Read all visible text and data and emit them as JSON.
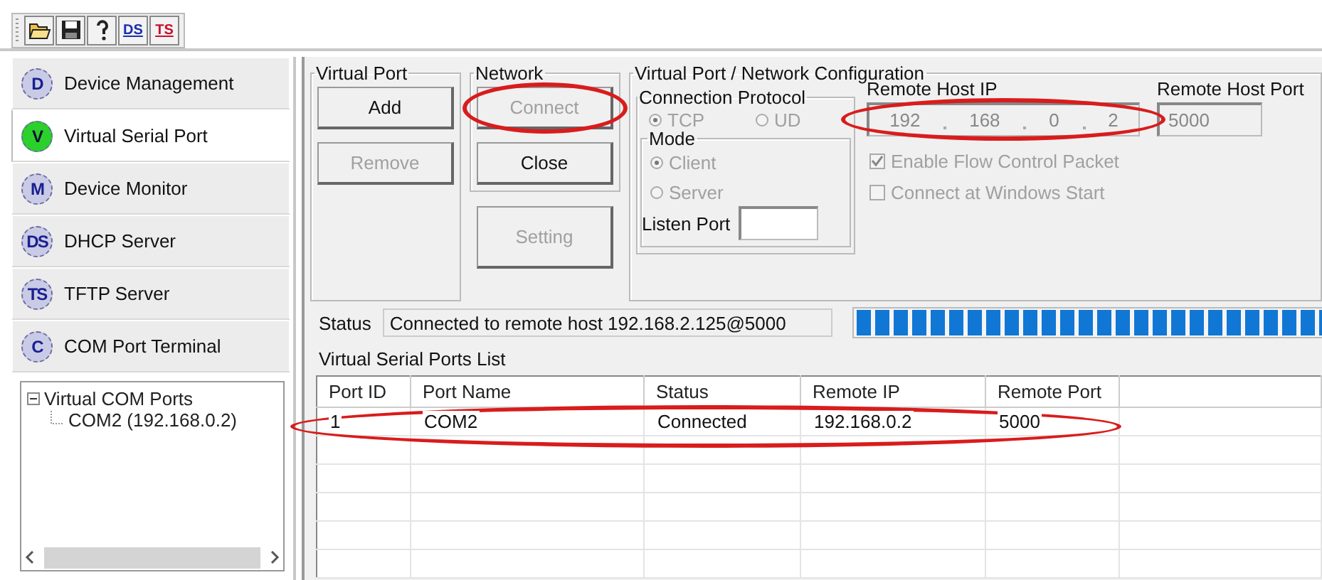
{
  "toolbar": {
    "buttons": [
      {
        "kind": "open"
      },
      {
        "kind": "save"
      },
      {
        "kind": "help"
      },
      {
        "kind": "text",
        "label": "DS",
        "color": "#1a2fb0"
      },
      {
        "kind": "text",
        "label": "TS",
        "color": "#c8102e"
      }
    ]
  },
  "sidebar": {
    "items": [
      {
        "badge": "D",
        "label": "Device Management",
        "selected": false
      },
      {
        "badge": "V",
        "label": "Virtual Serial Port",
        "selected": true
      },
      {
        "badge": "M",
        "label": "Device Monitor",
        "selected": false
      },
      {
        "badge": "DS",
        "label": "DHCP Server",
        "selected": false
      },
      {
        "badge": "TS",
        "label": "TFTP Server",
        "selected": false
      },
      {
        "badge": "C",
        "label": "COM Port Terminal",
        "selected": false
      }
    ]
  },
  "tree": {
    "items": [
      {
        "label": "Virtual COM Ports",
        "expanded": true,
        "children": [
          {
            "label": "COM2 (192.168.0.2)"
          }
        ]
      }
    ]
  },
  "virtual_port": {
    "title": "Virtual Port",
    "buttons": [
      {
        "label": "Add",
        "disabled": false,
        "highlighted": false
      },
      {
        "label": "Remove",
        "disabled": true,
        "highlighted": false
      }
    ]
  },
  "network": {
    "title": "Network",
    "buttons": [
      {
        "label": "Connect",
        "disabled": true,
        "highlighted": true
      },
      {
        "label": "Close",
        "disabled": false,
        "highlighted": false
      }
    ]
  },
  "setting_button": {
    "label": "Setting",
    "disabled": true,
    "highlighted": false
  },
  "configuration": {
    "title": "Virtual Port / Network Configuration",
    "protocol": {
      "title": "Connection Protocol",
      "options": [
        {
          "label": "TCP",
          "selected": true,
          "disabled": true
        },
        {
          "label": "UD",
          "selected": false,
          "disabled": true
        }
      ]
    },
    "mode": {
      "title": "Mode",
      "options": [
        {
          "label": "Client",
          "selected": true,
          "disabled": true
        },
        {
          "label": "Server",
          "selected": false,
          "disabled": true
        }
      ],
      "listen_port_label": "Listen Port"
    },
    "remote_host_ip": {
      "label": "Remote Host IP",
      "octets": [
        "192",
        "168",
        "0",
        "2"
      ],
      "highlighted": true
    },
    "remote_host_port": {
      "label": "Remote Host Port",
      "value": "5000"
    },
    "options": [
      {
        "label": "Enable Flow Control Packet",
        "checked": true,
        "disabled": true
      },
      {
        "label": "Connect at Windows Start",
        "checked": false,
        "disabled": true
      }
    ]
  },
  "status": {
    "label": "Status",
    "value": "Connected to remote host 192.168.2.125@5000",
    "level": 1
  },
  "ports_list": {
    "title": "Virtual Serial Ports List",
    "columns": [
      "Port ID",
      "Port Name",
      "Status",
      "Remote IP",
      "Remote Port"
    ],
    "rows": [
      {
        "cells": [
          "1",
          "COM2",
          "Connected",
          "192.168.0.2",
          "5000"
        ],
        "highlighted": true
      }
    ]
  }
}
